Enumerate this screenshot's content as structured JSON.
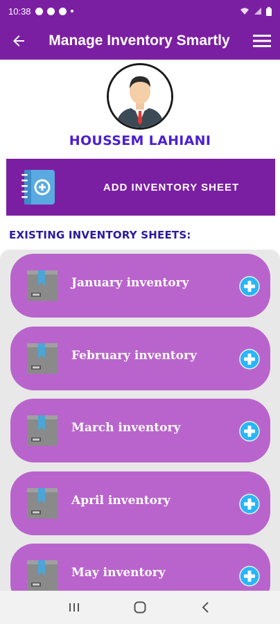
{
  "status": {
    "time": "10:38",
    "battery": ""
  },
  "app_bar": {
    "title": "Manage Inventory Smartly"
  },
  "profile": {
    "name": "HOUSSEM LAHIANI"
  },
  "add_sheet": {
    "label": "ADD INVENTORY SHEET"
  },
  "section": {
    "title": "EXISTING INVENTORY SHEETS:"
  },
  "sheets": [
    {
      "label": "January inventory"
    },
    {
      "label": "February inventory"
    },
    {
      "label": "March inventory"
    },
    {
      "label": "April inventory"
    },
    {
      "label": "May inventory"
    }
  ],
  "colors": {
    "primary": "#7b1fa2",
    "item": "#b964cc",
    "name": "#4b1fd0",
    "accent": "#29b6f6"
  },
  "icons": {
    "back": "arrow-left-icon",
    "menu": "hamburger-menu-icon",
    "add": "notebook-add-icon",
    "box": "box-icon",
    "plus": "plus-circle-icon"
  },
  "nav": {
    "recents": "recents-icon",
    "home": "home-icon",
    "back": "back-icon"
  }
}
